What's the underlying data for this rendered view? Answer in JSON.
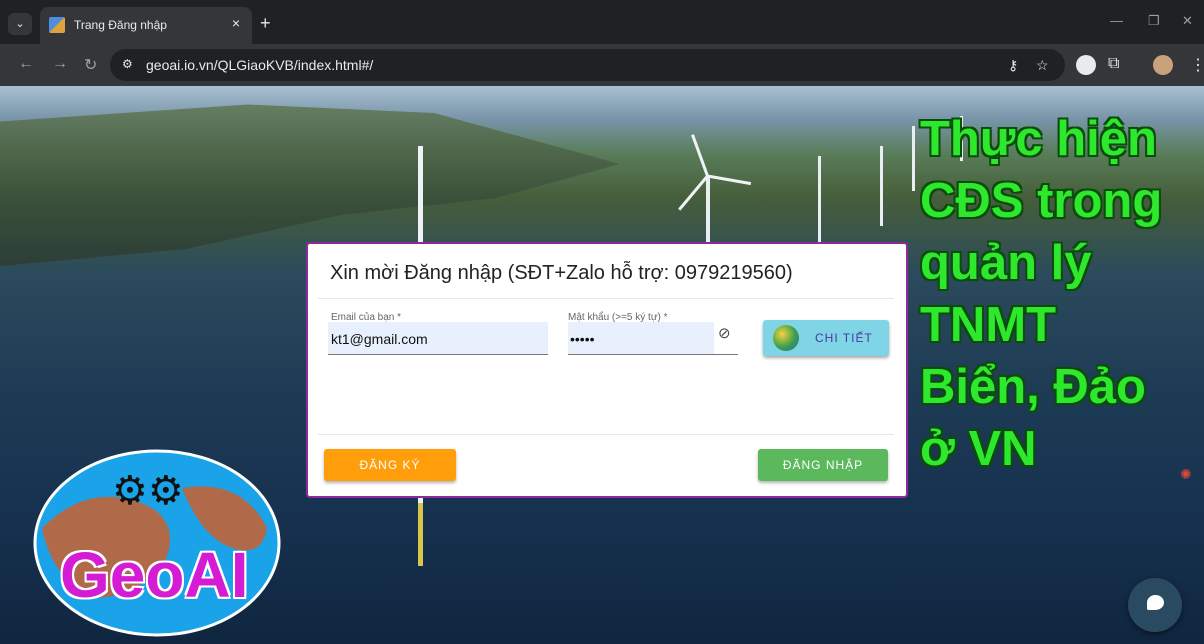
{
  "browser": {
    "tab_title": "Trang Đăng nhập",
    "tab_close": "×",
    "new_tab": "+",
    "url": "geoai.io.vn/QLGiaoKVB/index.html#/"
  },
  "dialog": {
    "title": "Xin mời Đăng nhập (SĐT+Zalo hỗ trợ: 0979219560)",
    "email_label": "Email của bạn *",
    "email_value": "kt1@gmail.com",
    "password_label": "Mật khẩu (>=5 ký tự) *",
    "password_value": "•••••",
    "detail_button": "CHI TIẾT",
    "register_button": "ĐĂNG KÝ",
    "login_button": "ĐĂNG NHẬP"
  },
  "slogan": [
    "Thực hiện",
    "CĐS trong",
    "quản lý",
    "TNMT",
    "Biển, Đảo",
    "ở VN"
  ],
  "logo": {
    "text": "GeoAI"
  },
  "icons": {
    "tab_menu": "chevron-down-icon",
    "close": "close-icon",
    "back": "back-arrow-icon",
    "forward": "forward-arrow-icon",
    "reload": "reload-icon",
    "site_info": "site-settings-icon",
    "key": "key-icon",
    "star": "star-icon",
    "extension": "puzzle-icon",
    "eye": "eye-off-icon",
    "chat": "chat-bubble-icon"
  },
  "colors": {
    "register": "#ff9d0a",
    "login": "#5cb85c",
    "detail": "#7fd4e6",
    "slogan": "#2ee82e",
    "dialog_border": "#8e2a9e"
  }
}
